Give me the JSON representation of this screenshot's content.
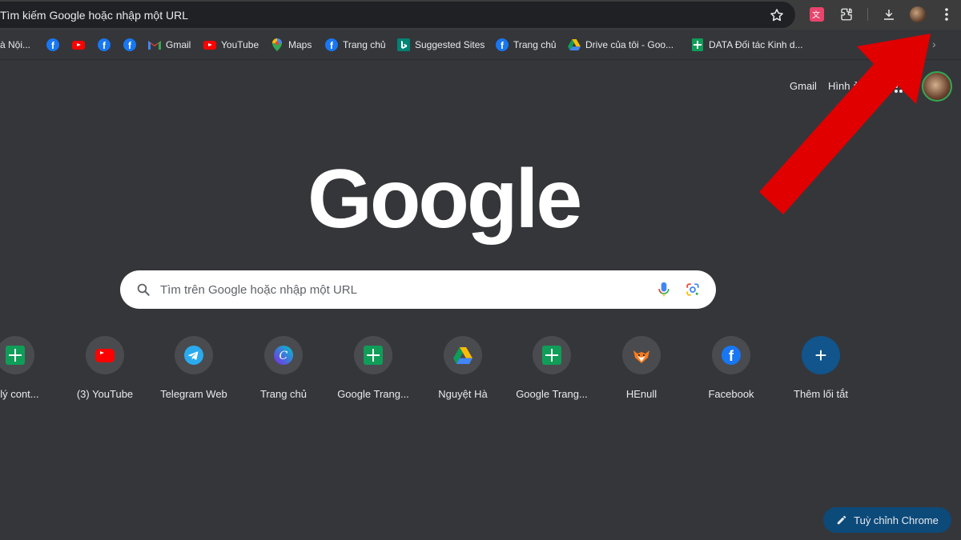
{
  "omnibox": {
    "text": "Tìm kiếm Google hoặc nhập một URL"
  },
  "bookmarks": [
    {
      "label": "à Nội...",
      "icon": "bookmark-icon"
    },
    {
      "label": "",
      "icon": "facebook-icon"
    },
    {
      "label": "",
      "icon": "youtube-icon"
    },
    {
      "label": "",
      "icon": "facebook-icon"
    },
    {
      "label": "",
      "icon": "facebook-icon"
    },
    {
      "label": "Gmail",
      "icon": "gmail-icon"
    },
    {
      "label": "YouTube",
      "icon": "youtube-icon"
    },
    {
      "label": "Maps",
      "icon": "maps-icon"
    },
    {
      "label": "Trang chủ",
      "icon": "facebook-icon"
    },
    {
      "label": "Suggested Sites",
      "icon": "bing-icon"
    },
    {
      "label": "Trang chủ",
      "icon": "facebook-icon"
    },
    {
      "label": "Drive của tôi - Goo...",
      "icon": "drive-icon"
    },
    {
      "label": "DATA Đối tác Kinh d...",
      "icon": "sheets-icon"
    }
  ],
  "header": {
    "gmail": "Gmail",
    "images": "Hình ảnh"
  },
  "logo": "Google",
  "search": {
    "placeholder": "Tìm trên Google hoặc nhập một URL"
  },
  "shortcuts": [
    {
      "label": "n lý cont...",
      "icon": "sheets-icon"
    },
    {
      "label": "(3) YouTube",
      "icon": "youtube-icon"
    },
    {
      "label": "Telegram Web",
      "icon": "telegram-icon"
    },
    {
      "label": "Trang chủ",
      "icon": "canva-icon"
    },
    {
      "label": "Google Trang...",
      "icon": "sheets-icon"
    },
    {
      "label": "Nguyệt Hà",
      "icon": "drive-icon"
    },
    {
      "label": "Google Trang...",
      "icon": "sheets-icon"
    },
    {
      "label": "HEnull",
      "icon": "fox-icon"
    },
    {
      "label": "Facebook",
      "icon": "facebook-icon"
    },
    {
      "label": "Thêm lối tắt",
      "icon": "plus-icon"
    }
  ],
  "customize": {
    "label": "Tuỳ chỉnh Chrome"
  },
  "colors": {
    "background": "#35363a",
    "annotation_arrow": "#e00000",
    "accent": "#0c4a7a"
  }
}
